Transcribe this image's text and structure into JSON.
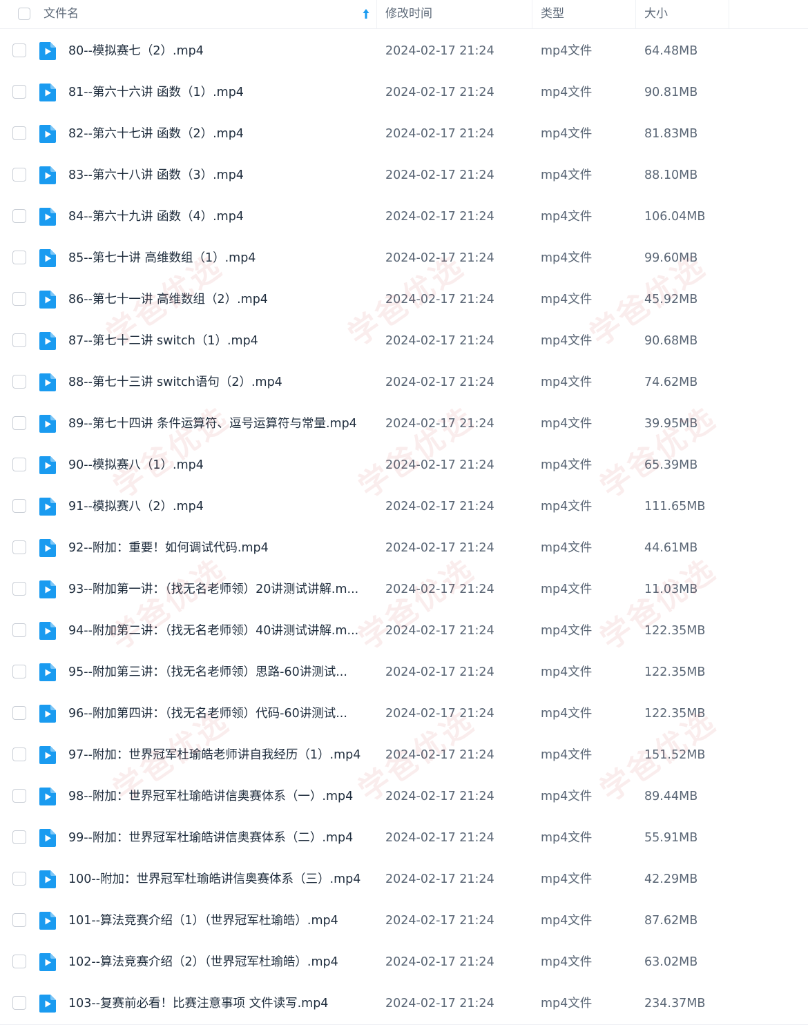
{
  "header": {
    "col_name": "文件名",
    "col_modified": "修改时间",
    "col_type": "类型",
    "col_size": "大小"
  },
  "files": [
    {
      "name": "80--模拟赛七（2）.mp4",
      "modified": "2024-02-17 21:24",
      "type": "mp4文件",
      "size": "64.48MB"
    },
    {
      "name": "81--第六十六讲 函数（1）.mp4",
      "modified": "2024-02-17 21:24",
      "type": "mp4文件",
      "size": "90.81MB"
    },
    {
      "name": "82--第六十七讲 函数（2）.mp4",
      "modified": "2024-02-17 21:24",
      "type": "mp4文件",
      "size": "81.83MB"
    },
    {
      "name": "83--第六十八讲 函数（3）.mp4",
      "modified": "2024-02-17 21:24",
      "type": "mp4文件",
      "size": "88.10MB"
    },
    {
      "name": "84--第六十九讲 函数（4）.mp4",
      "modified": "2024-02-17 21:24",
      "type": "mp4文件",
      "size": "106.04MB"
    },
    {
      "name": "85--第七十讲 高维数组（1）.mp4",
      "modified": "2024-02-17 21:24",
      "type": "mp4文件",
      "size": "99.60MB"
    },
    {
      "name": "86--第七十一讲 高维数组（2）.mp4",
      "modified": "2024-02-17 21:24",
      "type": "mp4文件",
      "size": "45.92MB"
    },
    {
      "name": "87--第七十二讲 switch（1）.mp4",
      "modified": "2024-02-17 21:24",
      "type": "mp4文件",
      "size": "90.68MB"
    },
    {
      "name": "88--第七十三讲 switch语句（2）.mp4",
      "modified": "2024-02-17 21:24",
      "type": "mp4文件",
      "size": "74.62MB"
    },
    {
      "name": "89--第七十四讲 条件运算符、逗号运算符与常量.mp4",
      "modified": "2024-02-17 21:24",
      "type": "mp4文件",
      "size": "39.95MB"
    },
    {
      "name": "90--模拟赛八（1）.mp4",
      "modified": "2024-02-17 21:24",
      "type": "mp4文件",
      "size": "65.39MB"
    },
    {
      "name": "91--模拟赛八（2）.mp4",
      "modified": "2024-02-17 21:24",
      "type": "mp4文件",
      "size": "111.65MB"
    },
    {
      "name": "92--附加：重要！如何调试代码.mp4",
      "modified": "2024-02-17 21:24",
      "type": "mp4文件",
      "size": "44.61MB"
    },
    {
      "name": "93--附加第一讲：（找无名老师领）20讲测试讲解.m...",
      "modified": "2024-02-17 21:24",
      "type": "mp4文件",
      "size": "11.03MB"
    },
    {
      "name": "94--附加第二讲：（找无名老师领）40讲测试讲解.m...",
      "modified": "2024-02-17 21:24",
      "type": "mp4文件",
      "size": "122.35MB"
    },
    {
      "name": "95--附加第三讲：（找无名老师领）思路-60讲测试...",
      "modified": "2024-02-17 21:24",
      "type": "mp4文件",
      "size": "122.35MB"
    },
    {
      "name": "96--附加第四讲：（找无名老师领）代码-60讲测试...",
      "modified": "2024-02-17 21:24",
      "type": "mp4文件",
      "size": "122.35MB"
    },
    {
      "name": "97--附加：世界冠军杜瑜皓老师讲自我经历（1）.mp4",
      "modified": "2024-02-17 21:24",
      "type": "mp4文件",
      "size": "151.52MB"
    },
    {
      "name": "98--附加：世界冠军杜瑜皓讲信奥赛体系（一）.mp4",
      "modified": "2024-02-17 21:24",
      "type": "mp4文件",
      "size": "89.44MB"
    },
    {
      "name": "99--附加：世界冠军杜瑜皓讲信奥赛体系（二）.mp4",
      "modified": "2024-02-17 21:24",
      "type": "mp4文件",
      "size": "55.91MB"
    },
    {
      "name": "100--附加：世界冠军杜瑜皓讲信奥赛体系（三）.mp4",
      "modified": "2024-02-17 21:24",
      "type": "mp4文件",
      "size": "42.29MB"
    },
    {
      "name": "101--算法竞赛介绍（1）（世界冠军杜瑜皓）.mp4",
      "modified": "2024-02-17 21:24",
      "type": "mp4文件",
      "size": "87.62MB"
    },
    {
      "name": "102--算法竞赛介绍（2）（世界冠军杜瑜皓）.mp4",
      "modified": "2024-02-17 21:24",
      "type": "mp4文件",
      "size": "63.02MB"
    },
    {
      "name": "103--复赛前必看！比赛注意事项 文件读写.mp4",
      "modified": "2024-02-17 21:24",
      "type": "mp4文件",
      "size": "234.37MB"
    }
  ],
  "watermark": "学爸优选",
  "colors": {
    "file_icon": "#1a9bf0",
    "checkbox_border": "#c9ced6",
    "sort_arrow": "#1a9bf0"
  }
}
